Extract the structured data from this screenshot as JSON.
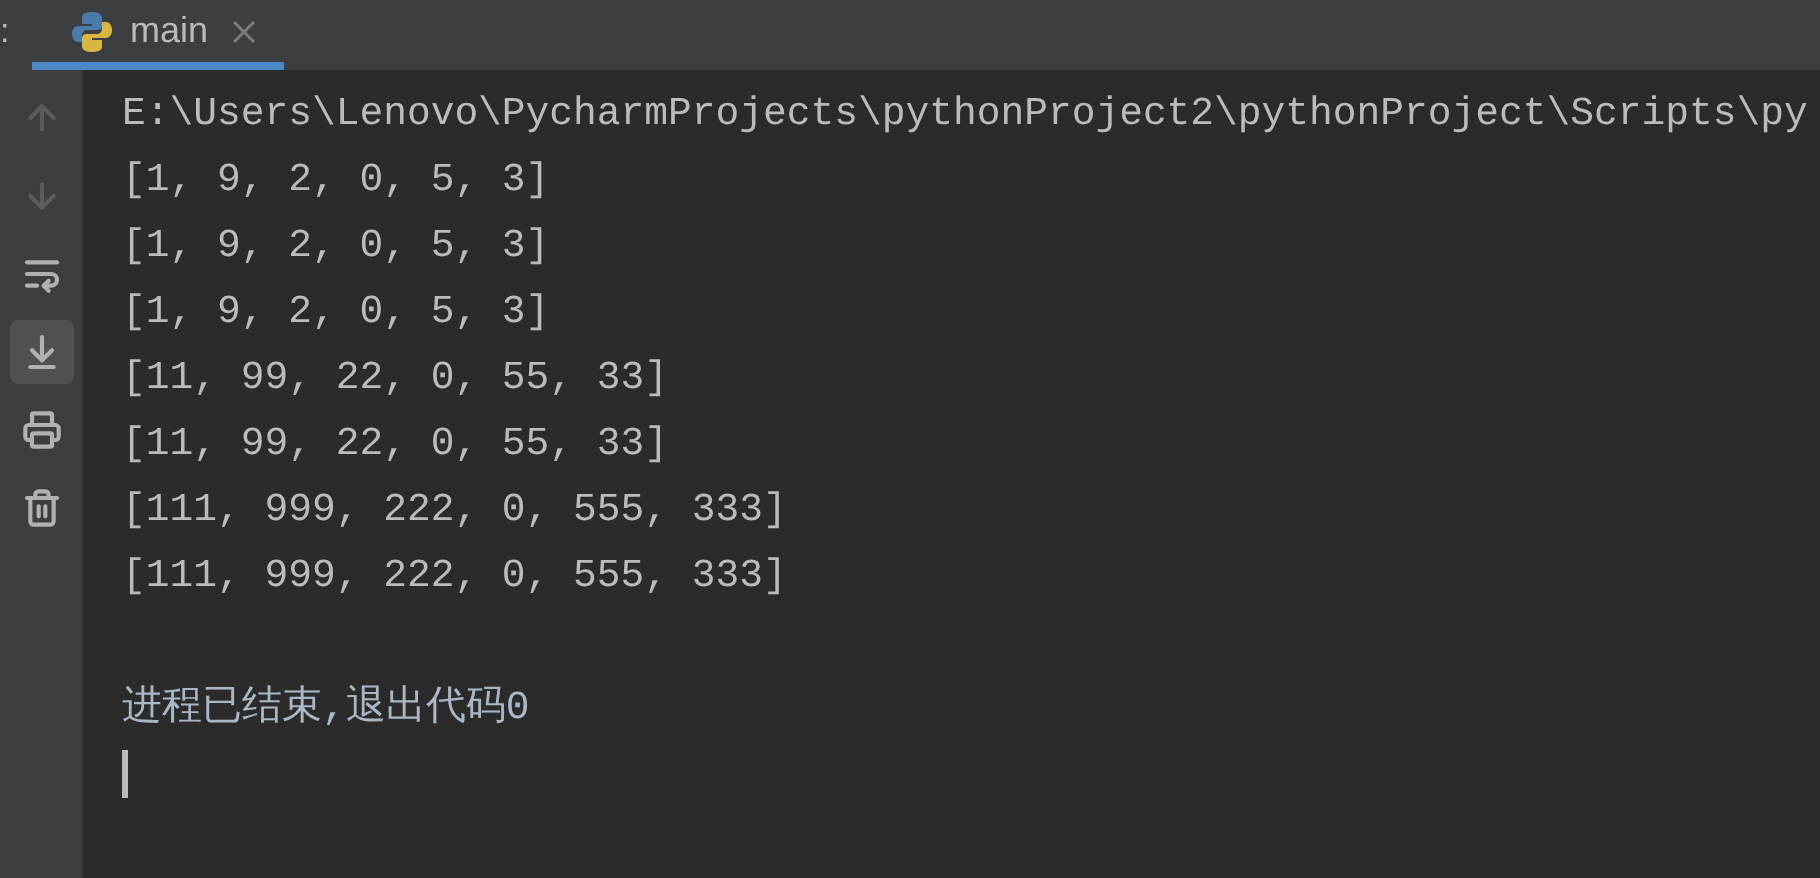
{
  "tab_strip": {
    "left_mark": ":",
    "tabs": [
      {
        "label": "main",
        "selected": true
      }
    ]
  },
  "toolbar": [
    {
      "kind": "up",
      "disabled": true,
      "selected": false
    },
    {
      "kind": "down",
      "disabled": true,
      "selected": false
    },
    {
      "kind": "wrap",
      "disabled": false,
      "selected": false
    },
    {
      "kind": "scroll_end",
      "disabled": false,
      "selected": true
    },
    {
      "kind": "print",
      "disabled": false,
      "selected": false
    },
    {
      "kind": "trash",
      "disabled": false,
      "selected": false
    }
  ],
  "console": {
    "lines": [
      {
        "kind": "command",
        "text": "E:\\Users\\Lenovo\\PycharmProjects\\pythonProject2\\pythonProject\\Scripts\\py"
      },
      {
        "kind": "output",
        "text": "[1, 9, 2, 0, 5, 3]"
      },
      {
        "kind": "output",
        "text": "[1, 9, 2, 0, 5, 3]"
      },
      {
        "kind": "output",
        "text": "[1, 9, 2, 0, 5, 3]"
      },
      {
        "kind": "output",
        "text": "[11, 99, 22, 0, 55, 33]"
      },
      {
        "kind": "output",
        "text": "[11, 99, 22, 0, 55, 33]"
      },
      {
        "kind": "output",
        "text": "[111, 999, 222, 0, 555, 333]"
      },
      {
        "kind": "output",
        "text": "[111, 999, 222, 0, 555, 333]"
      },
      {
        "kind": "blank"
      },
      {
        "kind": "exit",
        "text": "进程已结束,退出代码0"
      }
    ]
  }
}
